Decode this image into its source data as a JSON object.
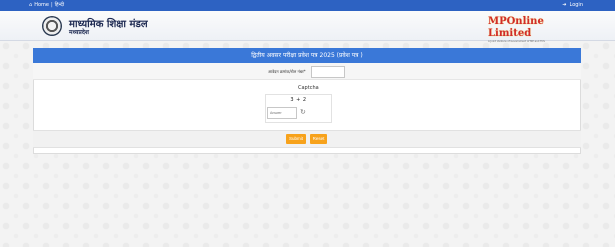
{
  "topbar": {
    "home_label": "Home",
    "separator": "|",
    "language_label": "हिन्दी",
    "login_label": "Login"
  },
  "header": {
    "org_name": "माध्यमिक शिक्षा मंडल",
    "org_location": "मध्यप्रदेश",
    "brand_name": "MPOnline Limited",
    "brand_tagline": "A Joint Venture of Government of MP and TCS"
  },
  "form": {
    "title": "द्वितीय अवसर परीक्षा  प्रवेश पत्र 2025 (प्रवेश पत्र )",
    "application_label": "आवेदन क्रमांक/रोल नंबर",
    "required_mark": "*",
    "application_value": ""
  },
  "captcha": {
    "label": "Captcha",
    "question": "3  +  2",
    "answer_placeholder": "Answer"
  },
  "buttons": {
    "submit_label": "Submit",
    "reset_label": "Reset"
  },
  "colors": {
    "topbar": "#2d62c2",
    "title_bar": "#3a78d8",
    "button": "#f7a21b"
  }
}
